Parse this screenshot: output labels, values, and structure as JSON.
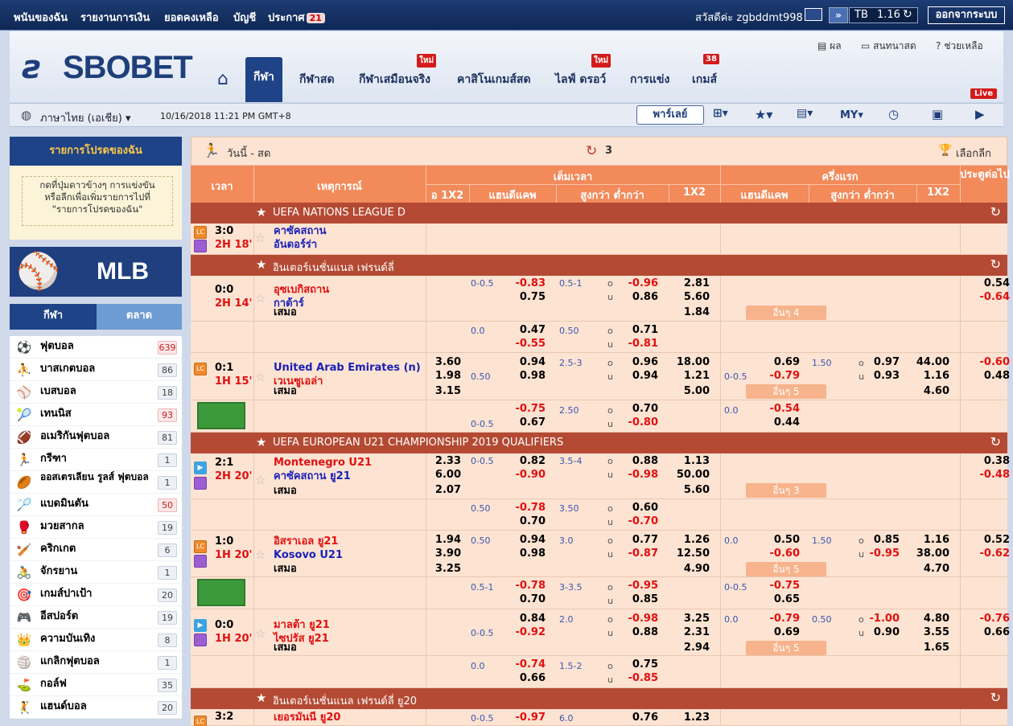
{
  "topbar": {
    "nav": [
      "พนันของฉัน",
      "รายงานการเงิน",
      "ยอดคงเหลือ",
      "บัญชี",
      "ประกาศ"
    ],
    "notice_count": "21",
    "welcome": "สวัสดีค่ะ zgbddmt998",
    "currency": "TB",
    "balance": "1.16",
    "logout": "ออกจากระบบ"
  },
  "header": {
    "logo": "SBOBET",
    "tabs": [
      "กีฬา",
      "กีฬาสด",
      "กีฬาเสมือนจริง",
      "คาสิโนเกมส์สด",
      "ไลฟ์ ดรอว์",
      "การแข่ง",
      "เกมส์"
    ],
    "new_badge": "ใหม่",
    "games_badge": "38",
    "util": [
      "ผล",
      "สนทนาสด",
      "ช่วยเหลือ"
    ]
  },
  "subhead": {
    "language": "ภาษาไทย (เอเชีย)",
    "datetime": "10/16/2018 11:21 PM GMT+8",
    "parlay": "พาร์เลย์",
    "odds_type": "MY",
    "live": "Live"
  },
  "sidebar": {
    "fav_title": "รายการโปรดของฉัน",
    "fav_hint": [
      "กดที่ปุ่มดาวข้างๆ การแข่งขัน",
      "หรือลีกเพื่อเพิ่มรายการไปที่",
      "\"รายการโปรดของฉัน\""
    ],
    "mlb": "MLB",
    "tab_sports": "กีฬา",
    "tab_market": "ตลาด",
    "sports": [
      {
        "name": "ฟุตบอล",
        "count": "639",
        "hot": true,
        "icon": "⚽"
      },
      {
        "name": "บาสเกตบอล",
        "count": "86",
        "icon": "⛹"
      },
      {
        "name": "เบสบอล",
        "count": "18",
        "icon": "⚾"
      },
      {
        "name": "เทนนิส",
        "count": "93",
        "hot": true,
        "icon": "🎾"
      },
      {
        "name": "อเมริกันฟุตบอล",
        "count": "81",
        "icon": "🏈"
      },
      {
        "name": "กรีฑา",
        "count": "1",
        "icon": "🏃"
      },
      {
        "name": "ออสเตรเลียน รูลส์ ฟุตบอล",
        "count": "1",
        "icon": "🏉",
        "two": true
      },
      {
        "name": "แบดมินตัน",
        "count": "50",
        "hot": true,
        "icon": "🏸"
      },
      {
        "name": "มวยสากล",
        "count": "19",
        "icon": "🥊"
      },
      {
        "name": "คริกเกต",
        "count": "6",
        "icon": "🏏"
      },
      {
        "name": "จักรยาน",
        "count": "1",
        "icon": "🚴"
      },
      {
        "name": "เกมส์ปาเป้า",
        "count": "20",
        "icon": "🎯"
      },
      {
        "name": "อีสปอร์ต",
        "count": "19",
        "icon": "🎮"
      },
      {
        "name": "ความบันเทิง",
        "count": "8",
        "icon": "👑"
      },
      {
        "name": "แกลิกฟุตบอล",
        "count": "1",
        "icon": "🏐"
      },
      {
        "name": "กอล์ฟ",
        "count": "35",
        "icon": "⛳"
      },
      {
        "name": "แฮนด์บอล",
        "count": "20",
        "icon": "🤾"
      }
    ]
  },
  "main": {
    "title": "วันนี้ - สด",
    "refresh_count": "3",
    "select_league": "เลือกลีก",
    "headers": {
      "time": "เวลา",
      "event": "เหตุการณ์",
      "fulltime": "เต็มเวลา",
      "firsthalf": "ครึ่งแรก",
      "x12": "อ 1X2",
      "hdp": "แฮนดีแคพ",
      "ou": "สูงกว่า ต่ำกว่า",
      "one_x2": "1X2",
      "hdp2": "แฮนดีแคพ",
      "ou2": "สูงกว่า ต่ำกว่า",
      "one_x2b": "1X2",
      "next": "ประตูต่อไป"
    },
    "leagues": [
      "UEFA NATIONS LEAGUE D",
      "อินเตอร์เนชั่นแนล เฟรนด์ลี่",
      "UEFA EUROPEAN U21 CHAMPIONSHIP 2019 QUALIFIERS",
      "อินเตอร์เนชั่นแนล เฟรนด์ลี่ ยู20"
    ],
    "draw": "เสมอ",
    "m1": {
      "score": "3:0",
      "time": "2H 18'",
      "home": "คาซัคสถาน",
      "away": "อันดอร์ร่า"
    },
    "m2": {
      "score": "0:0",
      "time": "2H 14'",
      "home": "อุซเบกิสถาน",
      "away": "กาต้าร์",
      "more": "อื่นๆ 4",
      "r1": [
        "0-0.5",
        "-0.83",
        "0.75",
        "0.5-1",
        "o",
        "u",
        "-0.96",
        "0.86",
        "2.81",
        "5.60",
        "1.84",
        "0.54",
        "-0.64"
      ],
      "r2": [
        "0.0",
        "0.47",
        "-0.55",
        "0.50",
        "o",
        "u",
        "0.71",
        "-0.81"
      ]
    },
    "m3": {
      "score": "0:1",
      "time": "1H 15'",
      "home": "United Arab Emirates (n)",
      "away": "เวเนซูเอล่า",
      "more": "อื่นๆ 5",
      "r1": [
        "3.60",
        "1.98",
        "3.15",
        "0.50",
        "0.94",
        "0.98",
        "2.5-3",
        "o",
        "u",
        "0.96",
        "0.94",
        "18.00",
        "1.21",
        "5.00",
        "0.69",
        "-0.79",
        "0-0.5",
        "1.50",
        "o",
        "u",
        "0.97",
        "0.93",
        "44.00",
        "1.16",
        "4.60",
        "-0.60",
        "0.48"
      ],
      "r2": [
        "-0.75",
        "0.67",
        "0-0.5",
        "2.50",
        "o",
        "u",
        "0.70",
        "-0.80",
        "0.0",
        "-0.54",
        "0.44"
      ]
    },
    "m4": {
      "score": "2:1",
      "time": "2H 20'",
      "home": "Montenegro U21",
      "away": "คาซัคสถาน ยู21",
      "more": "อื่นๆ 3",
      "r1": [
        "2.33",
        "6.00",
        "2.07",
        "0-0.5",
        "0.82",
        "-0.90",
        "3.5-4",
        "o",
        "u",
        "0.88",
        "-0.98",
        "1.13",
        "50.00",
        "5.60",
        "0.38",
        "-0.48"
      ],
      "r2": [
        "0.50",
        "-0.78",
        "0.70",
        "3.50",
        "o",
        "u",
        "0.60",
        "-0.70"
      ]
    },
    "m5": {
      "score": "1:0",
      "time": "1H 20'",
      "home": "อิสราเอล ยู21",
      "away": "Kosovo U21",
      "more": "อื่นๆ 5",
      "r1": [
        "1.94",
        "3.90",
        "3.25",
        "0.50",
        "0.94",
        "0.98",
        "3.0",
        "o",
        "u",
        "0.77",
        "-0.87",
        "1.26",
        "12.50",
        "4.90",
        "0.0",
        "0.50",
        "-0.60",
        "1.50",
        "o",
        "u",
        "0.85",
        "-0.95",
        "1.16",
        "38.00",
        "4.70",
        "0.52",
        "-0.62"
      ],
      "r2": [
        "0.5-1",
        "-0.78",
        "0.70",
        "3-3.5",
        "o",
        "u",
        "-0.95",
        "0.85",
        "0-0.5",
        "-0.75",
        "0.65"
      ]
    },
    "m6": {
      "score": "0:0",
      "time": "1H 20'",
      "home": "มาลต้า ยู21",
      "away": "ไซปรัส ยู21",
      "more": "อื่นๆ 5",
      "r1": [
        "0.84",
        "-0.92",
        "0-0.5",
        "2.0",
        "o",
        "u",
        "-0.98",
        "0.88",
        "3.25",
        "2.31",
        "2.94",
        "0.0",
        "-0.79",
        "0.69",
        "0.50",
        "o",
        "u",
        "-1.00",
        "0.90",
        "4.80",
        "3.55",
        "1.65",
        "-0.76",
        "0.66"
      ],
      "r2": [
        "0.0",
        "-0.74",
        "0.66",
        "1.5-2",
        "o",
        "u",
        "0.75",
        "-0.85"
      ]
    },
    "m7": {
      "score": "3:2",
      "home": "เยอรมันนี ยู20",
      "r1": [
        "0-0.5",
        "-0.97",
        "6.0",
        "0.76",
        "1.23"
      ]
    }
  }
}
